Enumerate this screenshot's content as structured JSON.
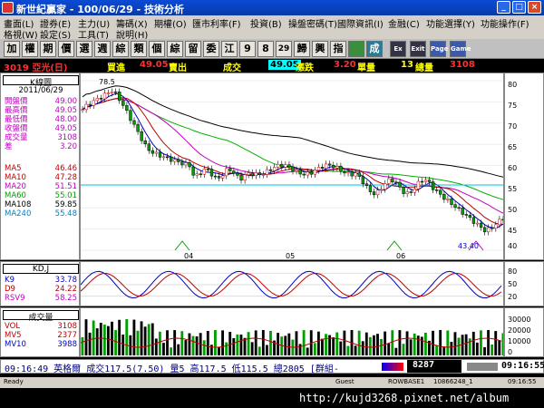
{
  "window": {
    "title": "新世紀贏家 - 100/06/29 - 技術分析",
    "min_label": "_",
    "max_label": "□",
    "close_label": "×"
  },
  "menu": {
    "row1": [
      "畫面(L)",
      "證券(E)",
      "主力(U)",
      "籌碼(X)",
      "期權(O)",
      "匯市利率(F)",
      "投資(B)",
      "操盤密碼(T)",
      "國際資訊(I)",
      "金融(C)",
      "功能選擇(Y)",
      "功能操作(F)"
    ],
    "row2": [
      "格視(W)",
      "設定(S)",
      "工具(T)",
      "說明(H)"
    ]
  },
  "toolbar": [
    "加",
    "權",
    "期",
    "價",
    "選",
    "週",
    "綜",
    "類",
    "個",
    "綜",
    "留",
    "委",
    "江",
    "9",
    "8",
    "29",
    "歸",
    "興",
    "指",
    "",
    "成",
    "Ex",
    "Exit",
    "Page",
    "Game"
  ],
  "info": {
    "code_name": "3019 亞光(日)",
    "bid_label": "買進",
    "bid": "49.05",
    "ask_label": "賣出",
    "trade_label": "成交",
    "trade": "49.05",
    "change_label": "漲跌",
    "change": "3.20",
    "vol_label": "單量",
    "vol": "13",
    "total_label": "總量",
    "total": "3108"
  },
  "kline": {
    "title": "K線圖",
    "date": "2011/06/29",
    "rows": [
      {
        "label": "開盤價",
        "value": "49.00"
      },
      {
        "label": "最高價",
        "value": "49.05"
      },
      {
        "label": "最低價",
        "value": "48.00"
      },
      {
        "label": "收盤價",
        "value": "49.05"
      },
      {
        "label": "成交量",
        "value": "3108"
      },
      {
        "label": "差",
        "value": "3.20"
      }
    ],
    "ma": [
      {
        "label": "MA5",
        "value": "46.46",
        "color": "#c00000"
      },
      {
        "label": "MA10",
        "value": "47.28",
        "color": "#c00000"
      },
      {
        "label": "MA20",
        "value": "51.51",
        "color": "#c000c0"
      },
      {
        "label": "MA60",
        "value": "55.01",
        "color": "#00a000"
      },
      {
        "label": "MA108",
        "value": "59.85",
        "color": "#000000"
      },
      {
        "label": "MA240",
        "value": "55.48",
        "color": "#0080c0"
      }
    ],
    "high_mark": "78.5",
    "low_mark": "43.40",
    "y_ticks": [
      "80",
      "75",
      "70",
      "65",
      "60",
      "55",
      "50",
      "45",
      "40"
    ],
    "x_ticks": [
      "04",
      "05",
      "06"
    ]
  },
  "kd": {
    "title": "KD,J",
    "rows": [
      {
        "label": "K9",
        "value": "33.78",
        "color": "#0000c0"
      },
      {
        "label": "D9",
        "value": "24.22",
        "color": "#c00000"
      },
      {
        "label": "RSV9",
        "value": "58.25",
        "color": "#c000c0"
      }
    ],
    "y_ticks": [
      "80",
      "50",
      "20"
    ]
  },
  "volume": {
    "title": "成交量",
    "rows": [
      {
        "label": "VOL",
        "value": "3108",
        "color": "#c00000"
      },
      {
        "label": "MV5",
        "value": "2377",
        "color": "#c00000"
      },
      {
        "label": "MV10",
        "value": "3988",
        "color": "#0000c0"
      }
    ],
    "y_ticks": [
      "30000",
      "20000",
      "10000",
      "0"
    ]
  },
  "status": {
    "ticker": "09:16:49 英格爾 成交117.5(7.50) 量5 高117.5 低115.5 總2805 [群組-",
    "index": "8287",
    "clock": "09:16:55"
  },
  "winstatus": {
    "ready": "Ready",
    "guest": "Guest",
    "rowbase": "ROWBASE1",
    "code": "10866248_1",
    "time": "09:16:55"
  },
  "watermark": "http://kujd3268.pixnet.net/album"
}
